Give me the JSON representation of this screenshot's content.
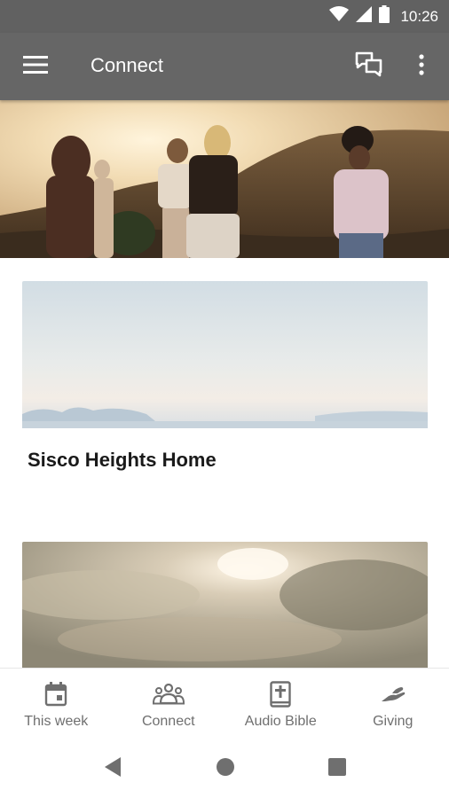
{
  "status_bar": {
    "time": "10:26",
    "icons": [
      "wifi-icon",
      "signal-icon",
      "battery-icon"
    ]
  },
  "app_bar": {
    "title": "Connect",
    "icons": [
      "menu-icon",
      "chat-icon",
      "more-vert-icon"
    ]
  },
  "cards": [
    {
      "title": "Sisco Heights Home"
    },
    {
      "title": ""
    }
  ],
  "bottom_nav": {
    "items": [
      {
        "label": "This week",
        "icon": "calendar-icon"
      },
      {
        "label": "Connect",
        "icon": "group-icon"
      },
      {
        "label": "Audio Bible",
        "icon": "bible-icon"
      },
      {
        "label": "Giving",
        "icon": "giving-hand-icon"
      }
    ]
  },
  "system_nav": {
    "icons": [
      "back-icon",
      "home-icon",
      "recents-icon"
    ]
  },
  "colors": {
    "app_bar": "#666666",
    "status_bar": "#616161",
    "nav_icon": "#6f6f6f"
  }
}
